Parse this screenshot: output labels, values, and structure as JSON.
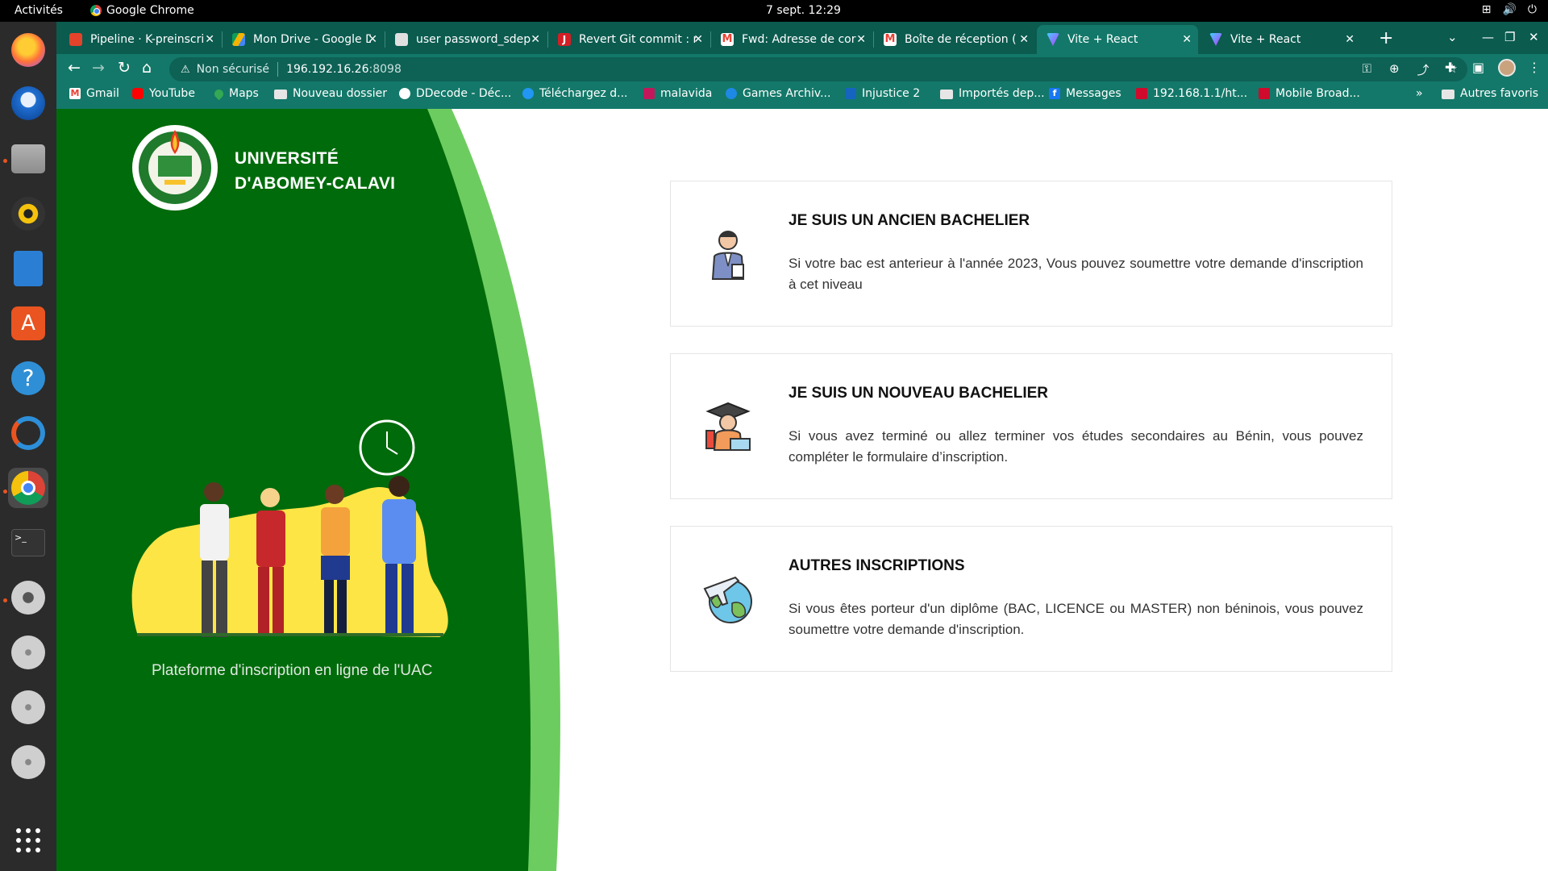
{
  "system": {
    "activities": "Activités",
    "app_name": "Google Chrome",
    "clock": "7 sept.  12:29"
  },
  "tabs": [
    {
      "label": "Pipeline · K-preinscri",
      "color": "#e2432a"
    },
    {
      "label": "Mon Drive - Google D",
      "color": "#f4b400"
    },
    {
      "label": "user password_sdep",
      "color": "#e0e0e0"
    },
    {
      "label": "Revert Git commit : r",
      "color": "#d21f26"
    },
    {
      "label": "Fwd: Adresse de cor",
      "color": "#ea4335"
    },
    {
      "label": "Boîte de réception (",
      "color": "#ea4335"
    },
    {
      "label": "Vite + React",
      "color": "#a259ff"
    },
    {
      "label": "Vite + React",
      "color": "#a259ff"
    }
  ],
  "address": {
    "warning": "Non sécurisé",
    "host": "196.192.16.26",
    "port": ":8098"
  },
  "bookmarks": [
    {
      "label": "Gmail",
      "color": "#ea4335"
    },
    {
      "label": "YouTube",
      "color": "#ff0000"
    },
    {
      "label": "Maps",
      "color": "#34a853"
    },
    {
      "label": "Nouveau dossier",
      "color": "folder"
    },
    {
      "label": "DDecode - Déc...",
      "color": "#ffffff"
    },
    {
      "label": "Téléchargez d...",
      "color": "#2196f3"
    },
    {
      "label": "malavida",
      "color": "#c2185b"
    },
    {
      "label": "Games Archiv...",
      "color": "#1e88e5"
    },
    {
      "label": "Injustice 2",
      "color": "#1565c0"
    },
    {
      "label": "Importés dep...",
      "color": "folder"
    },
    {
      "label": "Messages",
      "color": "#1877f2"
    },
    {
      "label": "192.168.1.1/ht...",
      "color": "#cf0a2c"
    },
    {
      "label": "Mobile Broad...",
      "color": "#cf0a2c"
    }
  ],
  "bookmarks_more": "»",
  "bookmarks_other": "Autres favoris",
  "page": {
    "university": [
      "UNIVERSITÉ",
      "D'ABOMEY-CALAVI"
    ],
    "tagline": "Plateforme d'inscription en ligne de l'UAC",
    "cards": [
      {
        "title": "JE SUIS UN ANCIEN BACHELIER",
        "text": "Si votre bac est anterieur à l'année 2023, Vous pouvez soumettre votre demande d'inscription à cet niveau"
      },
      {
        "title": "JE SUIS UN NOUVEAU BACHELIER",
        "text": "Si vous avez terminé ou allez terminer vos études secondaires au Bénin, vous pouvez compléter le formulaire d’inscription."
      },
      {
        "title": "AUTRES INSCRIPTIONS",
        "text": "Si vous êtes porteur d'un diplôme (BAC, LICENCE ou MASTER) non béninois, vous pouvez soumettre votre demande d'inscription."
      }
    ]
  },
  "colors": {
    "panel_green": "#006b0b",
    "panel_light_green": "#6dcc5f",
    "chrome_frame": "#0b5b4f",
    "chrome_toolbar": "#137869"
  }
}
